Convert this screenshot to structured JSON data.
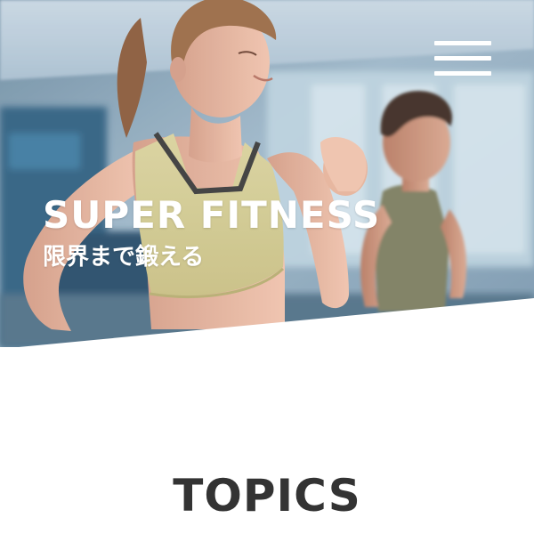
{
  "hero": {
    "title": "SUPER FITNESS",
    "subtitle": "限界まで鍛える",
    "image_alt": "women and man running on treadmills in a gym"
  },
  "nav": {
    "menu_icon": "hamburger-menu-icon"
  },
  "topics": {
    "heading": "TOPICS"
  },
  "colors": {
    "hero_text": "#ffffff",
    "heading": "#333333",
    "background": "#ffffff"
  }
}
